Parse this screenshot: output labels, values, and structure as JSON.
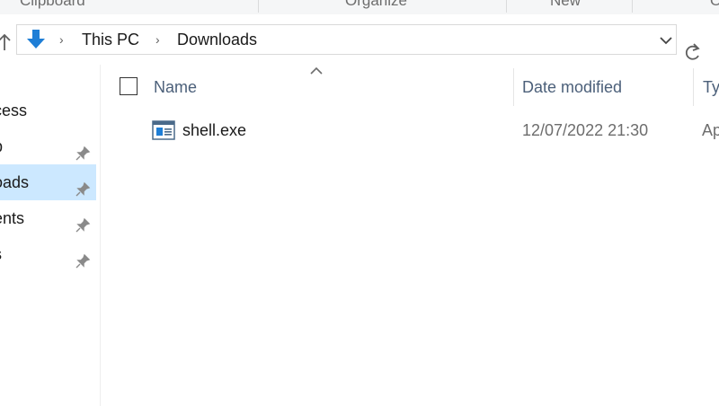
{
  "ribbon": {
    "groups": [
      "Clipboard",
      "Organize",
      "New",
      "O"
    ]
  },
  "address_bar": {
    "location_icon": "downloads-arrow-icon",
    "breadcrumbs": [
      "This PC",
      "Downloads"
    ]
  },
  "nav_pane": {
    "items": [
      {
        "label": "cess",
        "pinned": false,
        "selected": false
      },
      {
        "label": "p",
        "pinned": true,
        "selected": false
      },
      {
        "label": "oads",
        "pinned": true,
        "selected": true
      },
      {
        "label": "ents",
        "pinned": true,
        "selected": false
      },
      {
        "label": "s",
        "pinned": true,
        "selected": false
      }
    ]
  },
  "columns": {
    "name": "Name",
    "date_modified": "Date modified",
    "type": "Ty"
  },
  "files": [
    {
      "name": "shell.exe",
      "date_modified": "12/07/2022 21:30",
      "type": "Ap",
      "icon": "executable-icon"
    }
  ],
  "colors": {
    "selection": "#cce8ff",
    "header_text": "#4c607a",
    "accent_blue": "#1e7ed6"
  }
}
